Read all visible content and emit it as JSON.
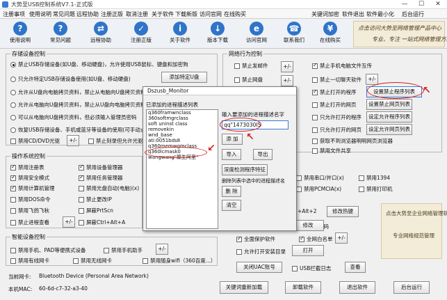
{
  "window": {
    "title": "大势至USB控制系统V7.1-正式版",
    "minimize": "—",
    "maximize": "☐",
    "close": "✕"
  },
  "menu": {
    "left": [
      "注册事项",
      "使用说明",
      "常见问题",
      "远程协助",
      "注册正版",
      "取消注册",
      "关于软件",
      "下载新版",
      "访问官网",
      "在线购买"
    ],
    "right": [
      "关键词加密",
      "软件退出",
      "软件最小化",
      "后台运行"
    ]
  },
  "toolbar": [
    {
      "label": "使用说明",
      "glyph": "?"
    },
    {
      "label": "常见问题",
      "glyph": "?"
    },
    {
      "label": "远程协助",
      "glyph": "⇄"
    },
    {
      "label": "注册正版",
      "glyph": "✓"
    },
    {
      "label": "关于软件",
      "glyph": "i"
    },
    {
      "label": "版本下载",
      "glyph": "↓"
    },
    {
      "label": "访问官网",
      "glyph": "e"
    },
    {
      "label": "联系我们",
      "glyph": "☎"
    },
    {
      "label": "在线购买",
      "glyph": "¥"
    }
  ],
  "banner": {
    "line1": "点击访问大势至网络管理产品中心",
    "line2": "专业、专注 一站式网络管理方案"
  },
  "storage": {
    "title": "存储设备控制",
    "radios": [
      {
        "label": "禁止USB存储设备(如U盘、移动硬盘)，允许使用USB鼠标、键盘和加密狗",
        "on": true
      },
      {
        "label": "只允许特定USB存储设备使用(如U盘、移动硬盘)",
        "on": false
      },
      {
        "label": "允许从U盘向电脑拷贝资料，禁止从电脑向U盘拷贝资料",
        "on": false
      },
      {
        "label": "允许从电脑向U盘拷贝资料，禁止从U盘向电脑拷贝资料",
        "on": false
      },
      {
        "label": "可以从电脑向U盘拷贝资料，但必须输入管理员密码",
        "on": false
      },
      {
        "label": "恢复USB存储设备、手机或蓝牙等设备的使用(可手动点击或",
        "on": false
      }
    ],
    "add_usb_button": "添加特定U盘",
    "cd_label": "禁用CD/DVD光驱",
    "burn_label": "禁止刻录但允许光驱使用",
    "plus_minus": "+/-"
  },
  "os": {
    "title": "操作系统控制",
    "items": [
      {
        "label": "禁用注册表",
        "on": true
      },
      {
        "label": "禁用设备管理器",
        "on": true
      },
      {
        "label": "禁用安全模式",
        "on": true
      },
      {
        "label": "禁用任务管理器",
        "on": true
      },
      {
        "label": "禁用计算机管理",
        "on": true
      },
      {
        "label": "禁用光盘自动(电脑)(x)",
        "on": false
      },
      {
        "label": "禁用DOS命令",
        "on": false
      },
      {
        "label": "禁止更改IP",
        "on": false
      },
      {
        "label": "禁用飞鸽飞秋",
        "on": false
      },
      {
        "label": "屏蔽PrtScn",
        "on": false
      },
      {
        "label": "禁止进程查看",
        "on": false
      },
      {
        "label": "屏蔽Ctrl+Alt+A",
        "on": false
      }
    ],
    "plus_minus": "+/-"
  },
  "smart": {
    "title": "智能设备控制",
    "items": [
      {
        "label": "禁用手机、PAD等便携式设备",
        "on": false
      },
      {
        "label": "禁用手机助手",
        "on": false
      },
      {
        "label": "禁用有线网卡",
        "on": false
      },
      {
        "label": "禁用无线网卡",
        "on": false
      },
      {
        "label": "禁用随身wifi（360百度...）",
        "on": false
      }
    ],
    "plus_minus": "+/-"
  },
  "network": {
    "title": "网络行为控制",
    "items": [
      {
        "label": "禁止发邮件",
        "on": false,
        "pm": true
      },
      {
        "label": "禁止手机电脑文件互传",
        "on": true
      },
      {
        "label": "禁止网盘",
        "on": false,
        "pm": true
      },
      {
        "label": "禁止一切聊天软件",
        "on": false,
        "pm": true
      },
      {
        "label": "禁止打开的程序",
        "on": true
      },
      {
        "label": "禁止打开的网页",
        "on": false
      },
      {
        "label": "只允许打开的程序",
        "on": false
      },
      {
        "label": "只允许打开的网页",
        "on": false
      },
      {
        "label": "获取不到浏览器明明网页浏览器",
        "on": false
      },
      {
        "label": "禁用文件共享",
        "on": false
      }
    ],
    "buttons": [
      "设置禁止程序列表",
      "设置禁止网页列表",
      "设定允许程序列表",
      "设定允许网页列表"
    ],
    "plus_minus": "+/-"
  },
  "right_mid": {
    "items": [
      {
        "label": "禁用串口/并口(x)",
        "on": false
      },
      {
        "label": "禁用1394",
        "on": false
      },
      {
        "label": "禁用PCMCIA(x)",
        "on": false
      },
      {
        "label": "禁用打印机",
        "on": false
      }
    ]
  },
  "right_low": {
    "hotkey_text": "+Alt+2",
    "hotkey_button": "修改热键",
    "password_text": "修改软件密码",
    "password_button": "修改",
    "protect_label": "全面保护软件",
    "whitelist_label": "全网白名单",
    "allow_install_label": "允许打开安装目录",
    "open_button": "打开",
    "uac_button": "关闭UAC账号",
    "usb_label": "USB拦截日志",
    "view_button": "查看",
    "plus_minus": "+/-"
  },
  "banner2": {
    "line1": "点击大势至企业网络管理软件",
    "line2": "专业网络规范管理"
  },
  "status": {
    "nic_label": "当前网卡:",
    "nic_value": "Bluetooth Device (Personal Area Network)",
    "mac_label": "本机MAC:",
    "mac_value": "60-6d-c7-32-a3-40"
  },
  "footer_buttons": [
    "关键词重新加载",
    "卸载软件",
    "退出软件",
    "后台运行"
  ],
  "dialog": {
    "title": "Dszusb_Monitor",
    "list_label": "已添加的进程描述列表",
    "list_items": [
      "q360framwnclass",
      "360softmgrclass",
      "soft uninst class",
      "removekin",
      "wnd_base",
      "ati:0051bds8",
      "q360memwgmclass",
      "q360lcmask0",
      "wangwang\"聚生阿里\""
    ],
    "input_label": "输入要添加的进程描述名字",
    "input_value": "qq\"1473030I5",
    "add_button": "添 加",
    "import_button": "导入",
    "export_button": "导出",
    "verify_button": "深度检测程序特征",
    "delete_label": "删除列表中选中的进程描述名",
    "delete_button": "删 除",
    "clear_button": "清空"
  }
}
